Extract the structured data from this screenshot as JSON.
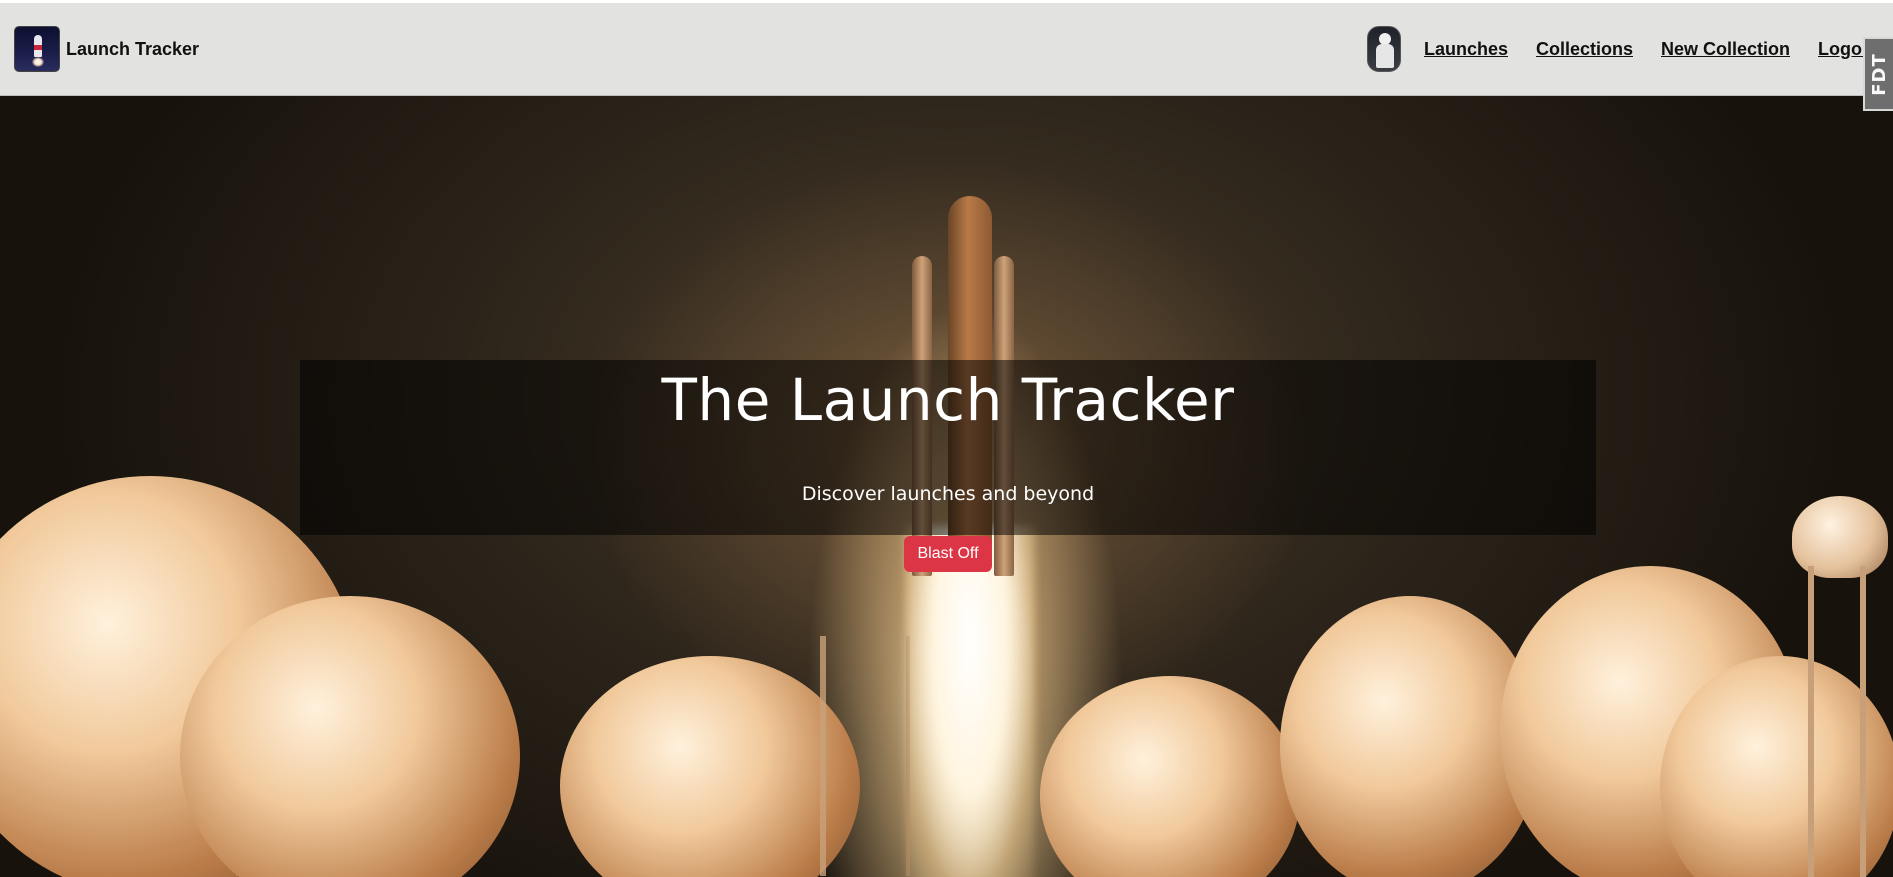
{
  "navbar": {
    "brand_name": "Launch Tracker",
    "links": [
      "Launches",
      "Collections",
      "New Collection",
      "Logout"
    ],
    "side_badge": "FDT"
  },
  "hero": {
    "title": "The Launch Tracker",
    "subtitle": "Discover launches and beyond",
    "button_label": "Blast Off",
    "button_color": "#dc3545"
  },
  "icons": {
    "brand": "rocket-logo-icon",
    "avatar": "astronaut-avatar-icon"
  }
}
